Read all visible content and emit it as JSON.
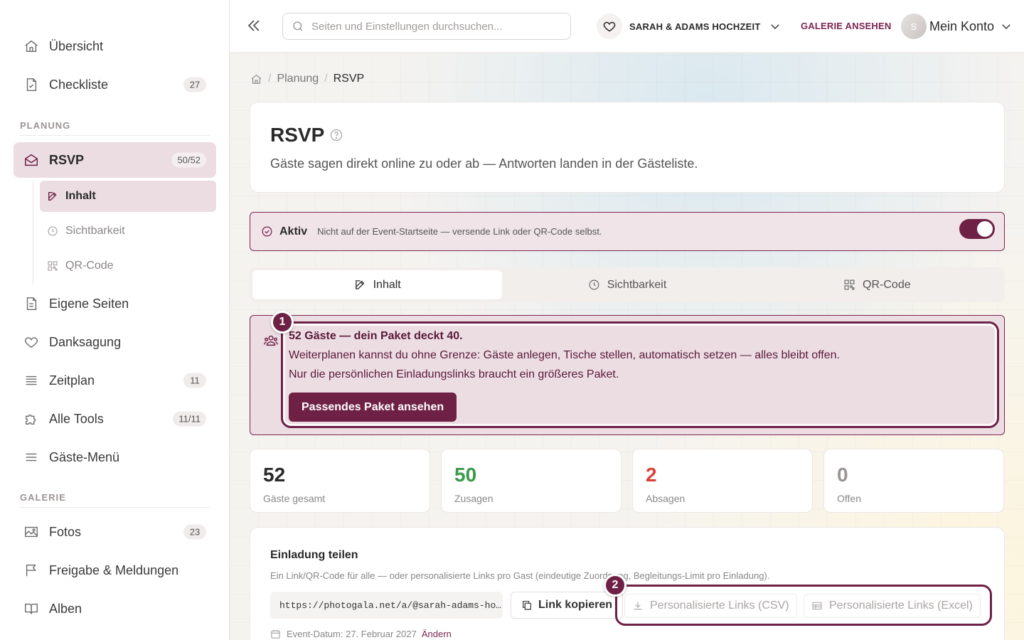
{
  "sidebar": {
    "items_top": [
      {
        "label": "Übersicht",
        "icon": "home-icon"
      },
      {
        "label": "Checkliste",
        "icon": "checklist-icon",
        "badge": "27"
      }
    ],
    "section_planung": "PLANUNG",
    "rsvp": {
      "label": "RSVP",
      "badge": "50/52"
    },
    "rsvp_sub": [
      {
        "label": "Inhalt"
      },
      {
        "label": "Sichtbarkeit"
      },
      {
        "label": "QR-Code"
      }
    ],
    "planung_items": [
      {
        "label": "Eigene Seiten"
      },
      {
        "label": "Danksagung"
      },
      {
        "label": "Zeitplan",
        "badge": "11"
      },
      {
        "label": "Alle Tools",
        "badge": "11/11"
      },
      {
        "label": "Gäste-Menü"
      }
    ],
    "section_galerie": "GALERIE",
    "galerie_items": [
      {
        "label": "Fotos",
        "badge": "23"
      },
      {
        "label": "Freigabe & Meldungen"
      },
      {
        "label": "Alben"
      }
    ]
  },
  "topbar": {
    "search_placeholder": "Seiten und Einstellungen durchsuchen...",
    "event_name": "SARAH & ADAMS HOCHZEIT",
    "gallery_link": "GALERIE ANSEHEN",
    "avatar_initial": "S",
    "account_label": "Mein Konto"
  },
  "breadcrumb": {
    "parent": "Planung",
    "current": "RSVP"
  },
  "header": {
    "title": "RSVP",
    "subtitle": "Gäste sagen direkt online zu oder ab — Antworten landen in der Gästeliste."
  },
  "status": {
    "label": "Aktiv",
    "note": "Nicht auf der Event-Startseite — versende Link oder QR-Code selbst.",
    "enabled": true
  },
  "tabs": [
    {
      "label": "Inhalt",
      "active": true
    },
    {
      "label": "Sichtbarkeit",
      "active": false
    },
    {
      "label": "QR-Code",
      "active": false
    }
  ],
  "alert": {
    "marker": "1",
    "title": "52 Gäste — dein Paket deckt 40.",
    "line1": "Weiterplanen kannst du ohne Grenze: Gäste anlegen, Tische stellen, automatisch setzen — alles bleibt offen.",
    "line2": "Nur die persönlichen Einladungslinks braucht ein größeres Paket.",
    "button": "Passendes Paket ansehen"
  },
  "stats": [
    {
      "value": "52",
      "label": "Gäste gesamt",
      "color": "#2a2a2a"
    },
    {
      "value": "50",
      "label": "Zusagen",
      "color": "#3a9a4a"
    },
    {
      "value": "2",
      "label": "Absagen",
      "color": "#d9413a"
    },
    {
      "value": "0",
      "label": "Offen",
      "color": "#9a9594"
    }
  ],
  "share": {
    "title": "Einladung teilen",
    "subtitle": "Ein Link/QR-Code für alle — oder personalisierte Links pro Gast (eindeutige Zuordnung, Begleitungs-Limit pro Einladung).",
    "link": "https://photogala.net/a/@sarah-adams-ho…",
    "copy_label": "Link kopieren",
    "marker": "2",
    "csv_label": "Personalisierte Links (CSV)",
    "excel_label": "Personalisierte Links (Excel)",
    "date_text": "Event-Datum: 27. Februar 2027",
    "date_change": "Ändern"
  },
  "colors": {
    "accent": "#6e2145",
    "active_bg": "#ecdde3"
  }
}
